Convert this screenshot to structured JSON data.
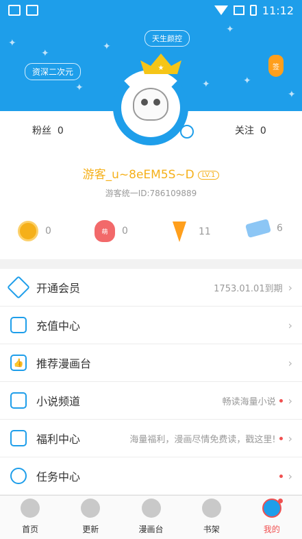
{
  "status_bar": {
    "time": "11:12"
  },
  "header": {
    "pill_top": "天生颜控",
    "pill_left": "资深二次元",
    "carrot_badge": "签"
  },
  "profile": {
    "fans_label": "粉丝",
    "fans_count": "0",
    "follow_label": "关注",
    "follow_count": "0",
    "username": "游客_u~8eEM5S~D",
    "level": "LV.1",
    "uid": "游客统一ID:786109889"
  },
  "assets": [
    {
      "icon": "coin-icon",
      "value": "0"
    },
    {
      "icon": "moe-bag-icon",
      "label": "萌",
      "value": "0"
    },
    {
      "icon": "carrot-icon",
      "value": "11"
    },
    {
      "icon": "ticket-icon",
      "value": "6"
    }
  ],
  "menu": [
    {
      "label": "开通会员",
      "hint": "1753.01.01到期",
      "icon": "vip-icon",
      "dot": false
    },
    {
      "label": "充值中心",
      "hint": "",
      "icon": "wallet-icon",
      "dot": false
    },
    {
      "label": "推荐漫画台",
      "hint": "",
      "icon": "thumbs-up-icon",
      "dot": false
    },
    {
      "label": "小说频道",
      "hint": "畅读海量小说",
      "icon": "book-icon",
      "dot": true
    },
    {
      "label": "福利中心",
      "hint": "海量福利，漫画尽情免费读，戳这里!",
      "icon": "gift-icon",
      "dot": true
    },
    {
      "label": "任务中心",
      "hint": "",
      "icon": "bunny-icon",
      "dot": true
    }
  ],
  "tabs": [
    {
      "label": "首页",
      "icon": "home-icon"
    },
    {
      "label": "更新",
      "icon": "rocket-icon"
    },
    {
      "label": "漫画台",
      "icon": "planet-icon"
    },
    {
      "label": "书架",
      "icon": "bookshelf-icon"
    },
    {
      "label": "我的",
      "icon": "astronaut-icon",
      "active": true
    }
  ],
  "colors": {
    "accent": "#1e9eea",
    "gold": "#f5b01a",
    "alert": "#f05050"
  }
}
